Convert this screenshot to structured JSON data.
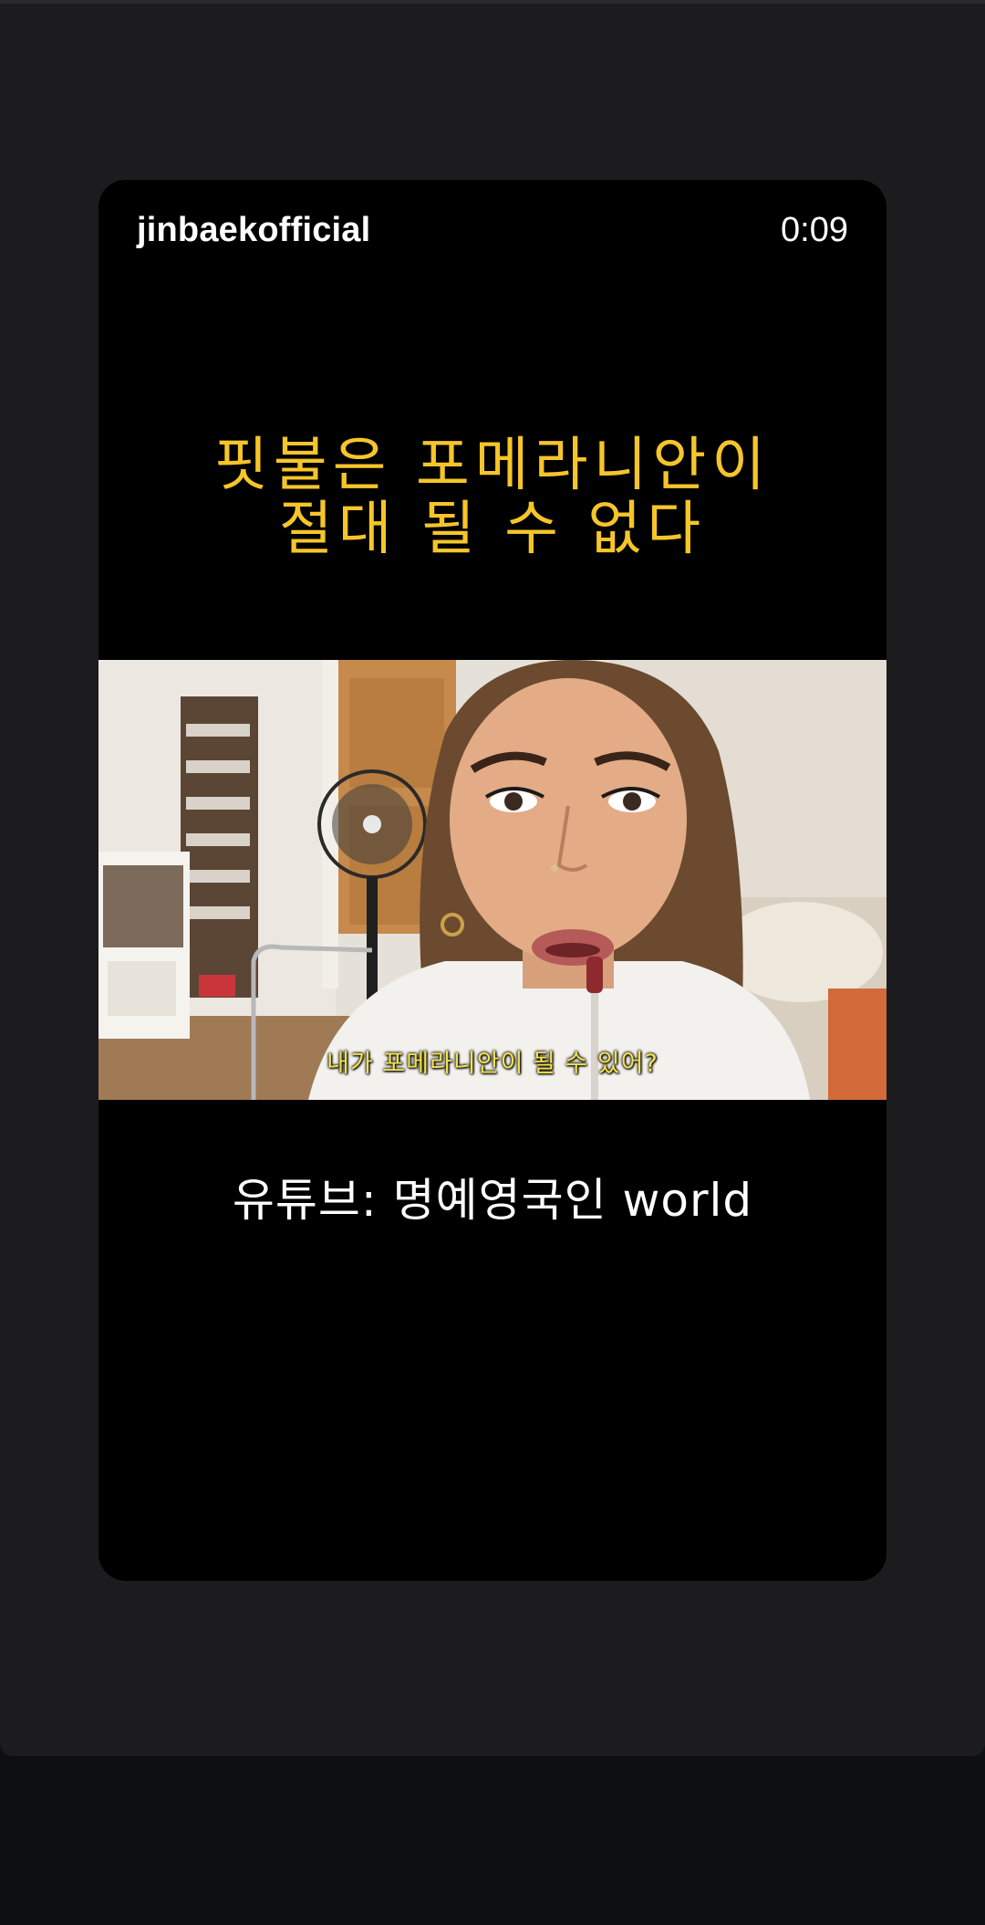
{
  "story": {
    "username": "jinbaekofficial",
    "elapsed_time": "0:09",
    "headline_line1": "핏불은 포메라니안이",
    "headline_line2": "절대 될 수 없다",
    "video_subtitle": "내가 포메라니안이 될 수 있어?",
    "caption": "유튜브: 명예영국인 world"
  },
  "colors": {
    "page_background": "#1c1c1e",
    "card_background": "#000000",
    "headline": "#f5c52a",
    "subtitle": "#f3e24a",
    "text": "#ffffff"
  }
}
